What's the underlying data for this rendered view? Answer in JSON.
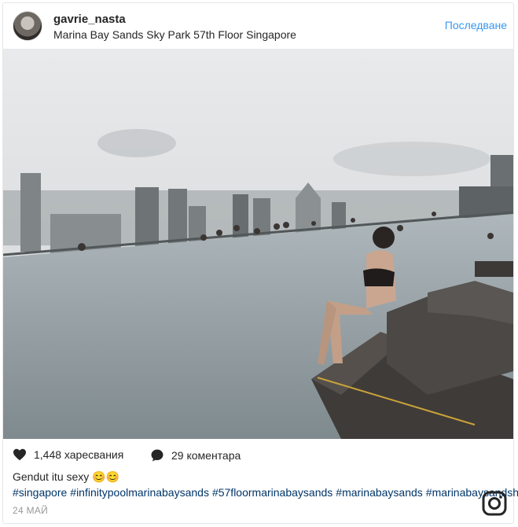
{
  "post": {
    "username": "gavrie_nasta",
    "location": "Marina Bay Sands Sky Park 57th Floor Singapore",
    "follow_label": "Последване"
  },
  "actions": {
    "likes": "1,448 харесвания",
    "comments": "29 коментара"
  },
  "caption": {
    "text": "Gendut itu sexy 😊😊",
    "hashtags": [
      "#singapore",
      "#infinitypoolmarinabaysands",
      "#57floormarinabaysands",
      "#marinabaysands",
      "#marinabaysandshotel"
    ]
  },
  "date": "24 МАЙ",
  "icons": {
    "like": "heart-icon",
    "comment": "comment-bubble-icon",
    "brand": "instagram-logo-icon"
  },
  "colors": {
    "link": "#003569",
    "follow": "#3897f0"
  }
}
